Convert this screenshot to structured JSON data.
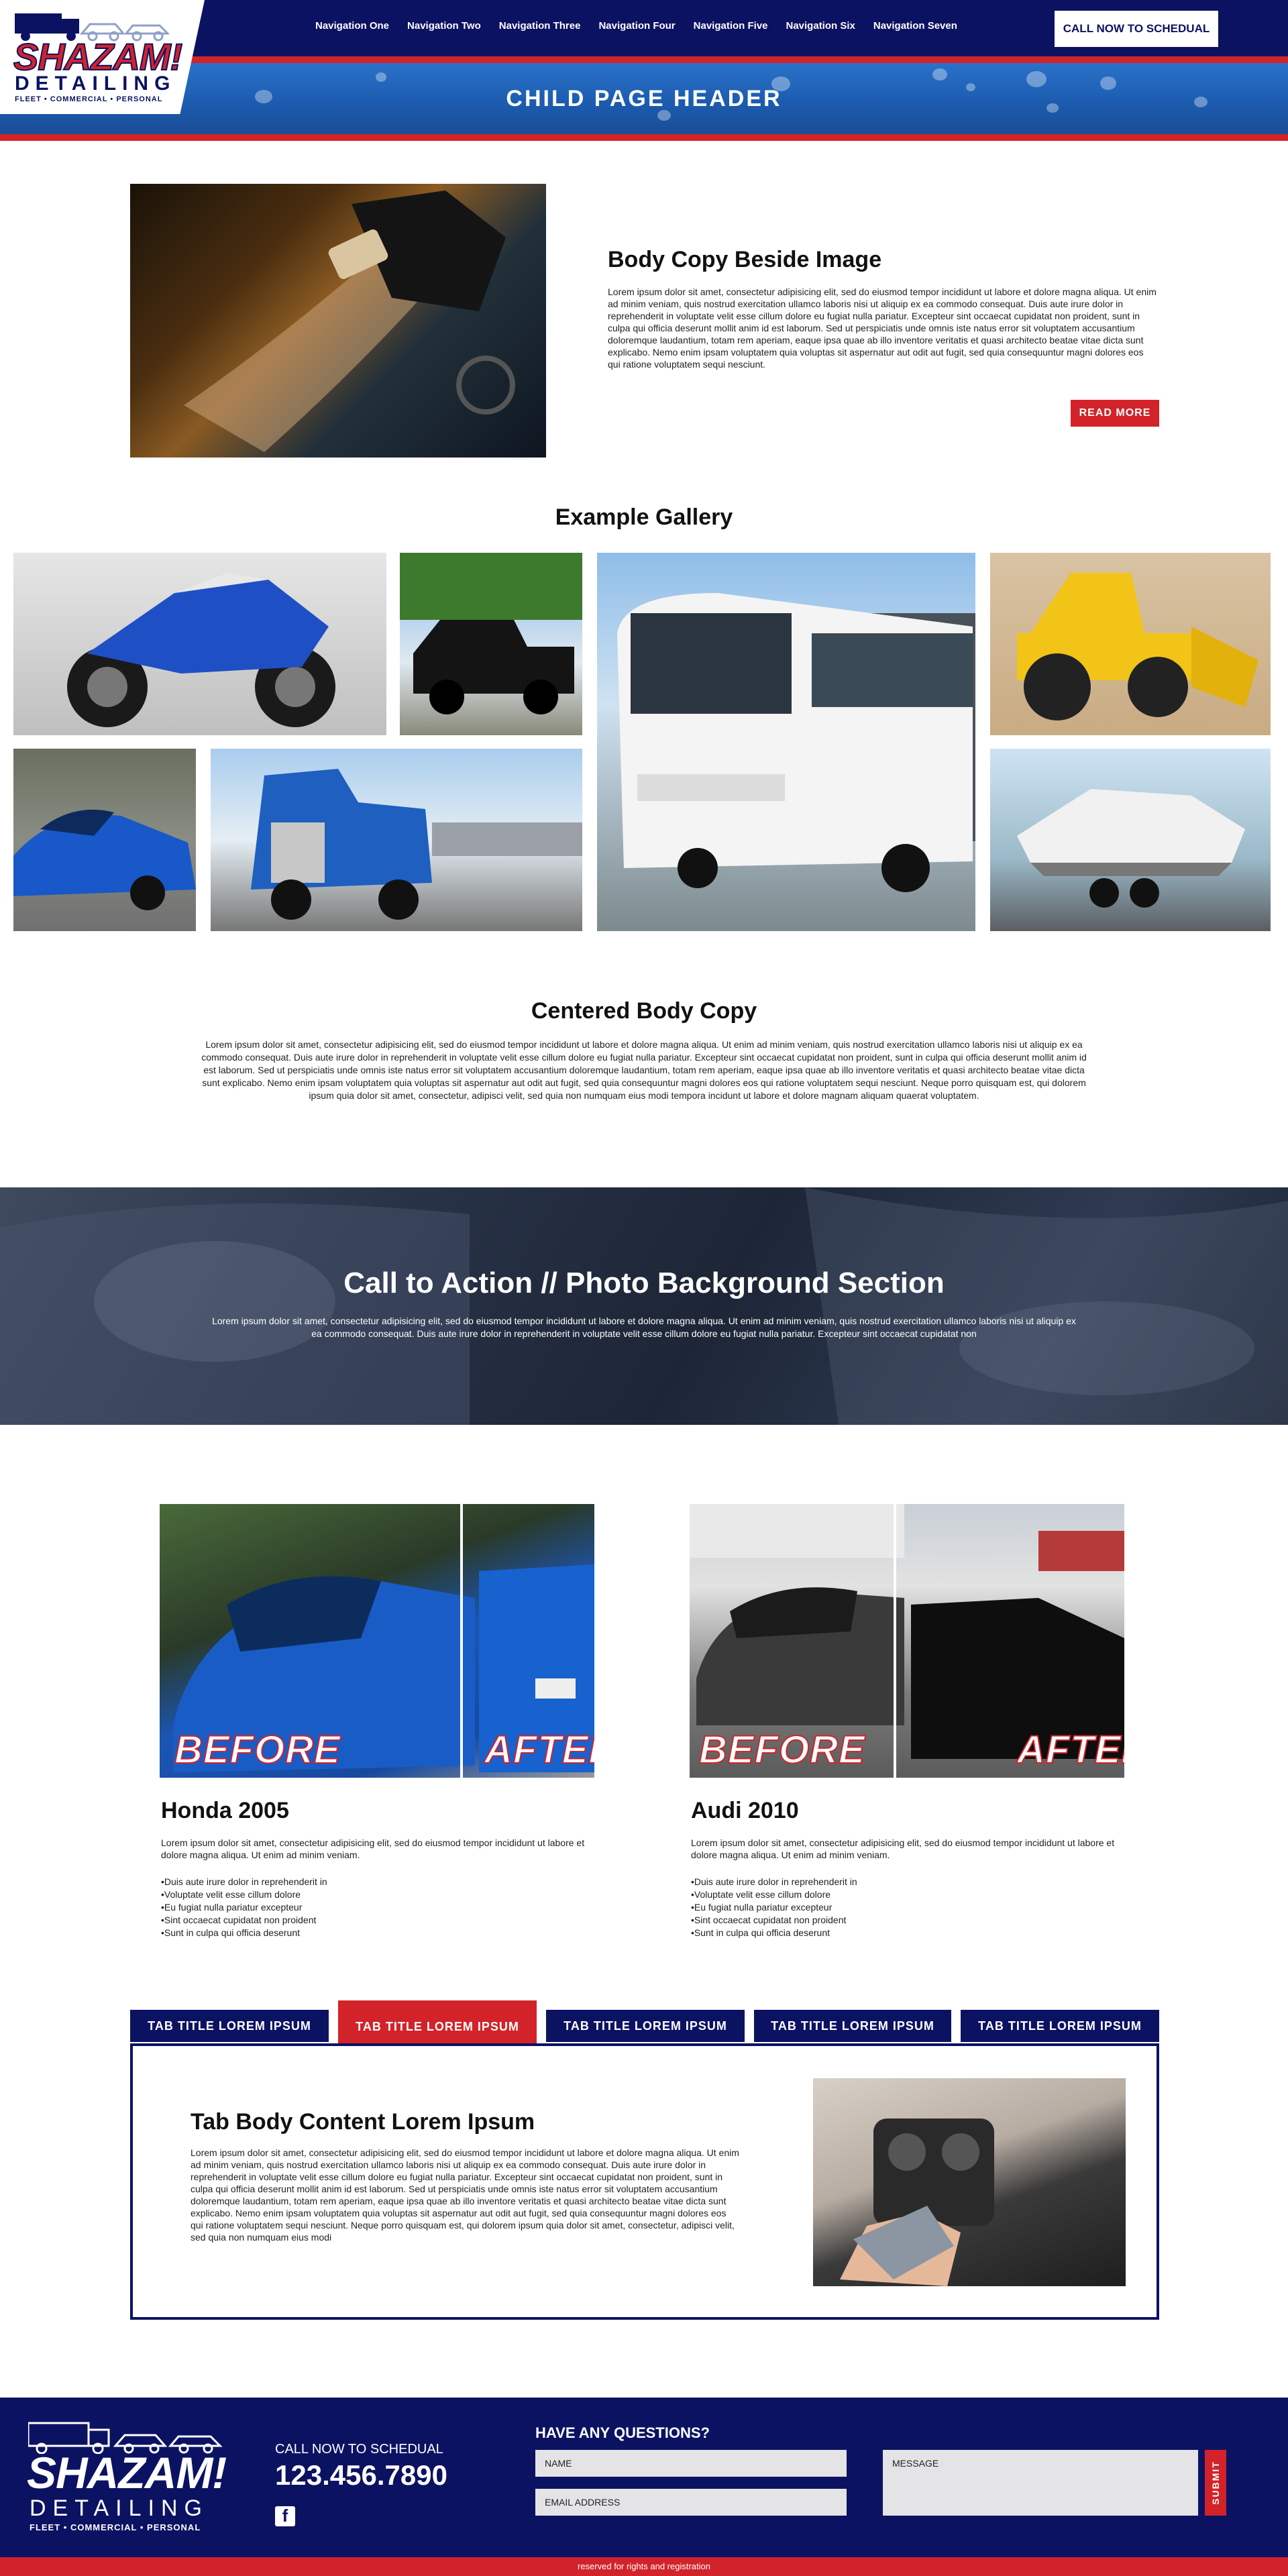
{
  "header": {
    "logo": {
      "main": "SHAZAM!",
      "sub": "DETAILING",
      "tagline": "FLEET • COMMERCIAL • PERSONAL"
    },
    "nav": [
      "Navigation One",
      "Navigation Two",
      "Navigation Three",
      "Navigation Four",
      "Navigation Five",
      "Navigation Six",
      "Navigation Seven"
    ],
    "call_button": "CALL NOW TO SCHEDUAL"
  },
  "hero": {
    "title": "CHILD PAGE HEADER"
  },
  "intro": {
    "image": "car-detailing-photo",
    "title": "Body Copy Beside Image",
    "body": "Lorem ipsum dolor sit amet, consectetur adipisicing elit, sed do eiusmod tempor incididunt ut labore et dolore magna aliqua. Ut enim ad minim veniam, quis nostrud exercitation ullamco laboris nisi ut aliquip ex ea commodo consequat. Duis aute irure dolor in reprehenderit in voluptate velit esse cillum dolore eu fugiat nulla pariatur. Excepteur sint occaecat cupidatat non proident, sunt in culpa qui officia deserunt mollit anim id est laborum. Sed ut perspiciatis unde omnis iste natus error sit voluptatem accusantium doloremque laudantium, totam rem aperiam, eaque ipsa quae ab illo inventore veritatis et quasi architecto beatae vitae dicta sunt explicabo. Nemo enim ipsam voluptatem quia voluptas sit aspernatur aut odit aut fugit, sed quia consequuntur magni dolores eos qui ratione voluptatem sequi nesciunt.",
    "button": "READ MORE"
  },
  "gallery": {
    "title": "Example Gallery",
    "items": [
      "motorcycle",
      "pickup-truck",
      "bus",
      "loader",
      "sports-car",
      "semi-truck",
      "boat"
    ]
  },
  "centered": {
    "title": "Centered Body Copy",
    "body": "Lorem ipsum dolor sit amet, consectetur adipisicing elit, sed do eiusmod tempor incididunt ut labore et dolore magna aliqua. Ut enim ad minim veniam, quis nostrud exercitation ullamco laboris nisi ut aliquip ex ea commodo consequat. Duis aute irure dolor in reprehenderit in voluptate velit esse cillum dolore eu fugiat nulla pariatur. Excepteur sint occaecat cupidatat non proident, sunt in culpa qui officia deserunt mollit anim id est laborum. Sed ut perspiciatis unde omnis iste natus error sit voluptatem accusantium doloremque laudantium, totam rem aperiam, eaque ipsa quae ab illo inventore veritatis et quasi architecto beatae vitae dicta sunt explicabo. Nemo enim ipsam voluptatem quia voluptas sit aspernatur aut odit aut fugit, sed quia consequuntur magni dolores eos qui ratione voluptatem sequi nesciunt. Neque porro quisquam est, qui dolorem ipsum quia dolor sit amet, consectetur, adipisci velit, sed quia non numquam eius modi tempora incidunt ut labore et dolore magnam aliquam quaerat voluptatem."
  },
  "cta": {
    "title": "Call to Action // Photo Background Section",
    "body": "Lorem ipsum dolor sit amet, consectetur adipisicing elit, sed do eiusmod tempor incididunt ut labore et dolore magna aliqua. Ut enim ad minim veniam, quis nostrud exercitation ullamco laboris nisi ut aliquip ex ea commodo consequat. Duis aute irure dolor in reprehenderit in voluptate velit esse cillum dolore eu fugiat nulla pariatur. Excepteur sint occaecat cupidatat non"
  },
  "cases": [
    {
      "title": "Honda 2005",
      "before_label": "BEFORE",
      "after_label": "AFTER",
      "body": "Lorem ipsum dolor sit amet, consectetur adipisicing elit, sed do eiusmod tempor incididunt ut labore et dolore magna aliqua. Ut enim ad minim veniam.",
      "bullets": [
        "•Duis aute irure dolor in reprehenderit in",
        "•Voluptate velit esse cillum dolore",
        "•Eu fugiat nulla pariatur excepteur",
        "•Sint occaecat cupidatat non proident",
        "•Sunt in culpa qui officia deserunt"
      ]
    },
    {
      "title": "Audi 2010",
      "before_label": "BEFORE",
      "after_label": "AFTER",
      "body": "Lorem ipsum dolor sit amet, consectetur adipisicing elit, sed do eiusmod tempor incididunt ut labore et dolore magna aliqua. Ut enim ad minim veniam.",
      "bullets": [
        "•Duis aute irure dolor in reprehenderit in",
        "•Voluptate velit esse cillum dolore",
        "•Eu fugiat nulla pariatur excepteur",
        "•Sint occaecat cupidatat non proident",
        "•Sunt in culpa qui officia deserunt"
      ]
    }
  ],
  "tabs": {
    "labels": [
      "TAB TITLE LOREM IPSUM",
      "TAB TITLE LOREM IPSUM",
      "TAB TITLE LOREM IPSUM",
      "TAB TITLE LOREM IPSUM",
      "TAB TITLE LOREM IPSUM"
    ],
    "active_index": 1,
    "content_title": "Tab Body Content Lorem Ipsum",
    "content_body": "Lorem ipsum dolor sit amet, consectetur adipisicing elit, sed do eiusmod tempor incididunt ut labore et dolore magna aliqua. Ut enim ad minim veniam, quis nostrud exercitation ullamco laboris nisi ut aliquip ex ea commodo consequat. Duis aute irure dolor in reprehenderit in voluptate velit esse cillum dolore eu fugiat nulla pariatur. Excepteur sint occaecat cupidatat non proident, sunt in culpa qui officia deserunt mollit anim id est laborum. Sed ut perspiciatis unde omnis iste natus error sit voluptatem accusantium doloremque laudantium, totam rem aperiam, eaque ipsa quae ab illo inventore veritatis et quasi architecto beatae vitae dicta sunt explicabo. Nemo enim ipsam voluptatem quia voluptas sit aspernatur aut odit aut fugit, sed quia consequuntur magni dolores eos qui ratione voluptatem sequi nesciunt. Neque porro quisquam est, qui dolorem ipsum quia dolor sit amet, consectetur, adipisci velit, sed quia non numquam eius modi"
  },
  "footer": {
    "logo": {
      "main": "SHAZAM!",
      "sub": "DETAILING",
      "tagline": "FLEET • COMMERCIAL • PERSONAL"
    },
    "call_label": "CALL NOW TO SCHEDUAL",
    "phone": "123.456.7890",
    "social": "f",
    "questions_title": "HAVE ANY QUESTIONS?",
    "name_placeholder": "NAME",
    "email_placeholder": "EMAIL ADDRESS",
    "message_placeholder": "MESSAGE",
    "submit": "SUBMIT",
    "copyright": "reserved for rights and registration"
  },
  "colors": {
    "navy": "#0c1262",
    "red": "#d2232a",
    "white": "#ffffff"
  }
}
